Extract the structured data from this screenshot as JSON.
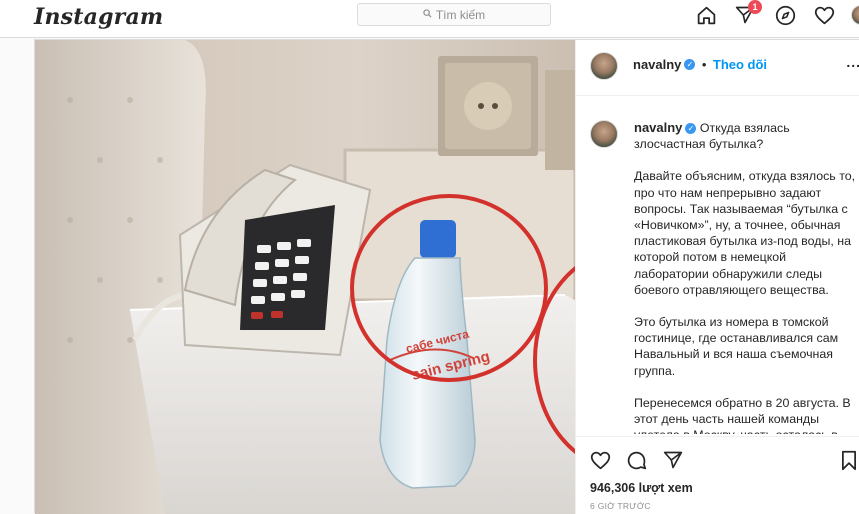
{
  "header": {
    "logo": "Instagram",
    "search_placeholder": "Tìm kiếm",
    "notification_count": "1",
    "icons": [
      "home-icon",
      "direct-icon",
      "explore-icon",
      "activity-icon",
      "profile-icon"
    ]
  },
  "post": {
    "username": "navalny",
    "follow_label": "Theo dõi",
    "more_label": "...",
    "caption_title": "Откуда взялась злосчастная бутылка?",
    "caption_paragraphs": [
      "Давайте объясним, откуда взялось то, про что нам непрерывно задают вопросы. Так называемая “бутылка с «Новичком»”, ну, а точнее, обычная пластиковая бутылка из-под воды, на которой потом в немецкой лаборатории обнаружили следы боевого отравляющего вещества.",
      "Это бутылка из номера в томской гостинице, где останавливался сам Навальный и вся наша съемочная группа.",
      "Перенесемся обратно в 20 августа. В этот день часть нашей команды улетела в Москву, часть осталась в"
    ],
    "views": "946,306 lượt xem",
    "timestamp": "6 giờ trước",
    "bottle_label": "sain spring",
    "bottle_label_top": "сабе чиста"
  },
  "colors": {
    "accent": "#0095f6",
    "verified": "#3897f0",
    "badge": "#ed4956",
    "circle": "#d3322c"
  }
}
